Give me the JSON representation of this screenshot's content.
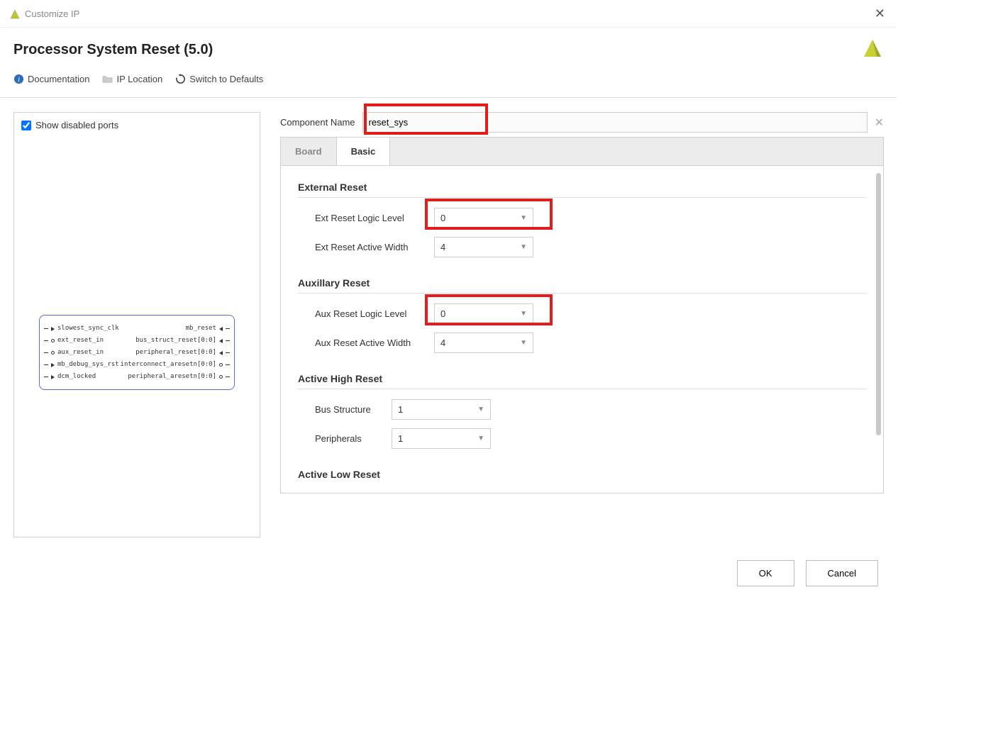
{
  "window": {
    "title": "Customize IP"
  },
  "header": {
    "page_title": "Processor System Reset (5.0)"
  },
  "toolbar": {
    "documentation": "Documentation",
    "ip_location": "IP Location",
    "switch_defaults": "Switch to Defaults"
  },
  "preview": {
    "show_disabled_ports_label": "Show disabled ports",
    "show_disabled_ports_checked": true,
    "ip_symbol": {
      "left_ports": [
        "slowest_sync_clk",
        "ext_reset_in",
        "aux_reset_in",
        "mb_debug_sys_rst",
        "dcm_locked"
      ],
      "right_ports": [
        "mb_reset",
        "bus_struct_reset[0:0]",
        "peripheral_reset[0:0]",
        "interconnect_aresetn[0:0]",
        "peripheral_aresetn[0:0]"
      ]
    }
  },
  "config": {
    "component_name_label": "Component Name",
    "component_name_value": "reset_sys",
    "tabs": {
      "board": "Board",
      "basic": "Basic",
      "active": "Basic"
    },
    "groups": {
      "external_reset": {
        "title": "External Reset",
        "fields": {
          "logic_level": {
            "label": "Ext Reset Logic Level",
            "value": "0"
          },
          "active_width": {
            "label": "Ext Reset Active Width",
            "value": "4"
          }
        }
      },
      "aux_reset": {
        "title": "Auxillary Reset",
        "fields": {
          "logic_level": {
            "label": "Aux Reset Logic Level",
            "value": "0"
          },
          "active_width": {
            "label": "Aux Reset Active Width",
            "value": "4"
          }
        }
      },
      "active_high_reset": {
        "title": "Active High Reset",
        "fields": {
          "bus_structure": {
            "label": "Bus Structure",
            "value": "1"
          },
          "peripherals": {
            "label": "Peripherals",
            "value": "1"
          }
        }
      },
      "active_low_reset": {
        "title": "Active Low Reset"
      }
    }
  },
  "buttons": {
    "ok": "OK",
    "cancel": "Cancel"
  }
}
